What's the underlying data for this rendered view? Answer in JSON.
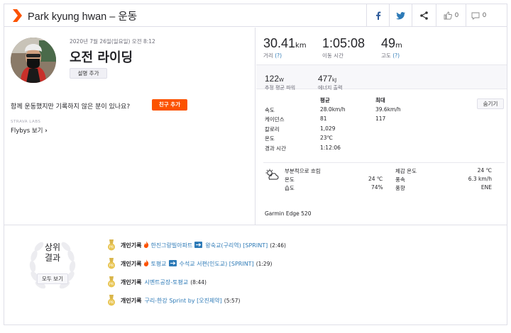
{
  "header": {
    "title": "Park kyung hwan – 운동",
    "kudos_count": "0",
    "comment_count": "0",
    "brand_color": "#fc5200"
  },
  "activity": {
    "date": "2020년 7월 26일(일요일) 오전 8:12",
    "name": "오전 라이딩",
    "add_description_label": "설명 추가",
    "prompt": "함께 운동했지만 기록하지 않은 분이 있나요?",
    "add_friend_label": "친구 추가",
    "labs_label": "STRAVA LABS",
    "flybys_label": "Flybys 보기"
  },
  "primary_stats": {
    "distance": {
      "value": "30.41",
      "unit": "km",
      "label": "거리"
    },
    "moving_time": {
      "value": "1:05:08",
      "label": "이동 시간"
    },
    "elevation": {
      "value": "49",
      "unit": "m",
      "label": "고도"
    }
  },
  "secondary_stats": {
    "power": {
      "value": "122",
      "unit": "W",
      "label": "추정 평균 파워"
    },
    "energy": {
      "value": "477",
      "unit": "kJ",
      "label": "에너지 출력"
    }
  },
  "details_table": {
    "headers": {
      "avg": "평균",
      "max": "최대"
    },
    "hide_label": "숨기기",
    "rows": [
      {
        "label": "속도",
        "avg": "28.0km/h",
        "max": "39.6km/h"
      },
      {
        "label": "케이던스",
        "avg": "81",
        "max": "117"
      },
      {
        "label": "칼로리",
        "avg": "1,029",
        "max": ""
      },
      {
        "label": "온도",
        "avg": "23℃",
        "max": ""
      },
      {
        "label": "경과 시간",
        "avg": "1:12:06",
        "max": ""
      }
    ]
  },
  "weather": {
    "condition": "부분적으로 흐림",
    "temp_label": "온도",
    "temp_value": "24 ℃",
    "humidity_label": "습도",
    "humidity_value": "74%",
    "feels_label": "체감 온도",
    "feels_value": "24 ℃",
    "wind_speed_label": "풍속",
    "wind_speed_value": "6.3 km/h",
    "wind_dir_label": "풍향",
    "wind_dir_value": "ENE"
  },
  "device": "Garmin Edge 520",
  "top_results": {
    "title_line1": "상위",
    "title_line2": "결과",
    "view_all_label": "모두 보기",
    "items": [
      {
        "pr": "개인기록",
        "segment": "한진그랑빌아파트",
        "segment2": "왕숙교(구리역) [SPRINT]",
        "time": "(2:46)"
      },
      {
        "pr": "개인기록",
        "segment": "토평교",
        "segment2": "수석교 서편(인도교) [SPRINT]",
        "time": "(1:29)"
      },
      {
        "pr": "개인기록",
        "segment": "시멘트공장-토평교",
        "segment2": "",
        "time": "(8:44)"
      },
      {
        "pr": "개인기록",
        "segment": "구리-한강 Sprint by [오진제약]",
        "segment2": "",
        "time": "(5:57)"
      }
    ]
  }
}
